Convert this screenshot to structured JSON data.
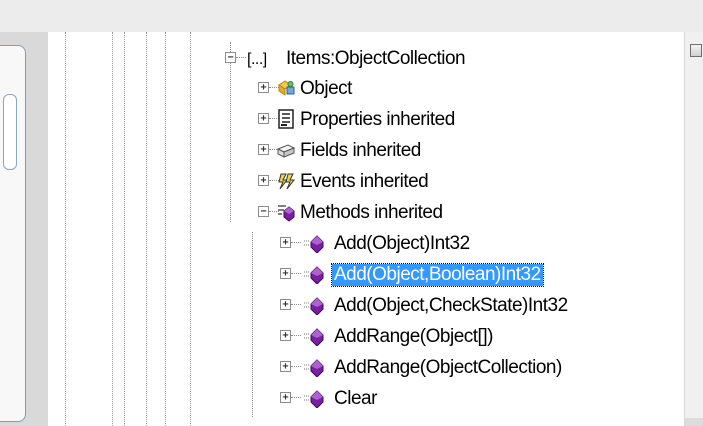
{
  "tree": {
    "root": {
      "bracket": "[...]",
      "label": "Items:ObjectCollection",
      "expander": "−"
    },
    "groups": [
      {
        "label": "Object",
        "expander": "+",
        "icon": "object-type-icon"
      },
      {
        "label": "Properties inherited",
        "expander": "+",
        "icon": "properties-icon"
      },
      {
        "label": "Fields inherited",
        "expander": "+",
        "icon": "fields-icon"
      },
      {
        "label": "Events inherited",
        "expander": "+",
        "icon": "events-icon"
      },
      {
        "label": "Methods inherited",
        "expander": "−",
        "icon": "methods-icon"
      }
    ],
    "methods": [
      {
        "label": "Add(Object)Int32",
        "selected": false
      },
      {
        "label": "Add(Object,Boolean)Int32",
        "selected": true
      },
      {
        "label": "Add(Object,CheckState)Int32",
        "selected": false
      },
      {
        "label": "AddRange(Object[])",
        "selected": false
      },
      {
        "label": "AddRange(ObjectCollection)",
        "selected": false
      },
      {
        "label": "Clear",
        "selected": false
      }
    ],
    "method_expander": "+",
    "method_icon": "method-icon"
  },
  "colors": {
    "selection": "#3399ff",
    "method_purple": "#7a1fa0",
    "topbar": "#ececec"
  }
}
